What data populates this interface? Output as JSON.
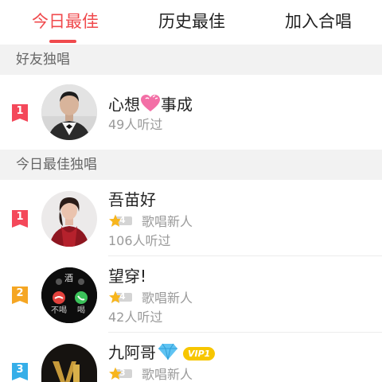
{
  "tabs": [
    {
      "label": "今日最佳",
      "active": true
    },
    {
      "label": "历史最佳",
      "active": false
    },
    {
      "label": "加入合唱",
      "active": false
    }
  ],
  "sections": {
    "friends_solo": "好友独唱",
    "today_best_solo": "今日最佳独唱"
  },
  "friend_entries": [
    {
      "rank": "1",
      "name_before": "心想",
      "name_after": "事成",
      "emoji": "heart-icon",
      "listeners": "49人听过"
    }
  ],
  "today_entries": [
    {
      "rank": "1",
      "name": "吾苗好",
      "level": "4",
      "title": "歌唱新人",
      "listeners": "106人听过"
    },
    {
      "rank": "2",
      "name": "望穿!",
      "level": "4",
      "title": "歌唱新人",
      "listeners": "42人听过"
    },
    {
      "rank": "3",
      "name": "九阿哥",
      "emoji": "diamond-icon",
      "vip": "VIP1",
      "level": "3",
      "title": "歌唱新人"
    }
  ],
  "avatar_texts": {
    "phone_center": "酒",
    "phone_left": "不喝",
    "phone_right": "喝"
  },
  "colors": {
    "accent": "#f04a4d",
    "rank_1": "#f4485a",
    "rank_2": "#f5a623",
    "rank_3": "#35aee8",
    "vip": "#f7c600",
    "section_bg": "#f2f2f2"
  }
}
